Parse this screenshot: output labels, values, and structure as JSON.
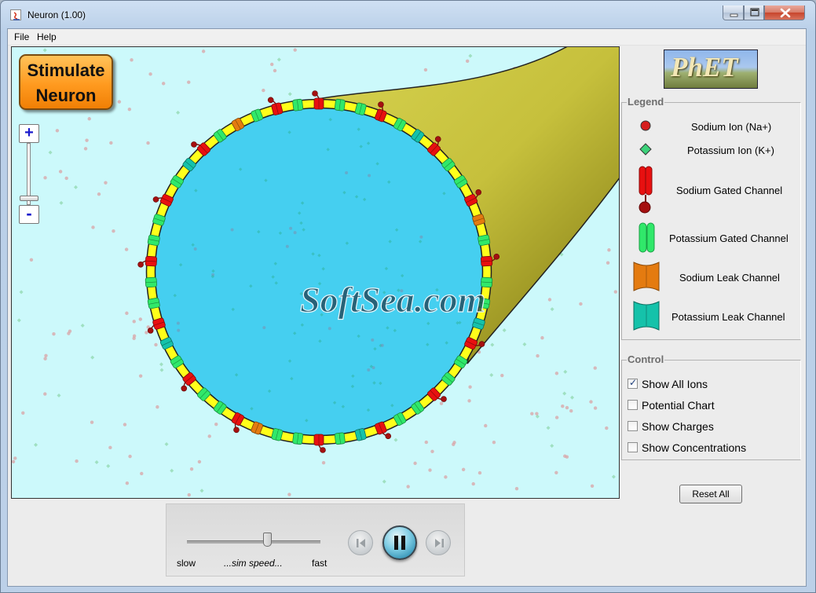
{
  "window": {
    "title": "Neuron (1.00)"
  },
  "menu": {
    "items": [
      "File",
      "Help"
    ]
  },
  "play_area": {
    "stimulate_button": {
      "line1": "Stimulate",
      "line2": "Neuron"
    },
    "zoom": {
      "in_label": "+",
      "out_label": "-"
    },
    "watermark": "SoftSea.com",
    "colors": {
      "background": "#ccf9fb",
      "cell_interior": "#45cff0",
      "membrane": "#ffff1a",
      "axon": "#c7c23e",
      "sodium_ion": "#cc1414",
      "potassium_ion": "#39d772"
    }
  },
  "legend": {
    "title": "Legend",
    "items": [
      {
        "label": "Sodium Ion (Na+)",
        "icon": "sodium-ion-icon",
        "color": "#d61e1e"
      },
      {
        "label": "Potassium Ion (K+)",
        "icon": "potassium-ion-icon",
        "color": "#3cd27a"
      },
      {
        "label": "Sodium Gated Channel",
        "icon": "sodium-gated-channel-icon",
        "color": "#e81010"
      },
      {
        "label": "Potassium Gated Channel",
        "icon": "potassium-gated-channel-icon",
        "color": "#30e86a"
      },
      {
        "label": "Sodium Leak Channel",
        "icon": "sodium-leak-channel-icon",
        "color": "#e47b10"
      },
      {
        "label": "Potassium Leak Channel",
        "icon": "potassium-leak-channel-icon",
        "color": "#15c2aa"
      }
    ]
  },
  "control": {
    "title": "Control",
    "options": [
      {
        "label": "Show All Ions",
        "checked": true
      },
      {
        "label": "Potential Chart",
        "checked": false
      },
      {
        "label": "Show Charges",
        "checked": false
      },
      {
        "label": "Show Concentrations",
        "checked": false
      }
    ]
  },
  "reset_label": "Reset All",
  "logo_text": "PhET",
  "sim_speed": {
    "slow_label": "slow",
    "mid_label": "...sim speed...",
    "fast_label": "fast",
    "value": 0.6
  }
}
